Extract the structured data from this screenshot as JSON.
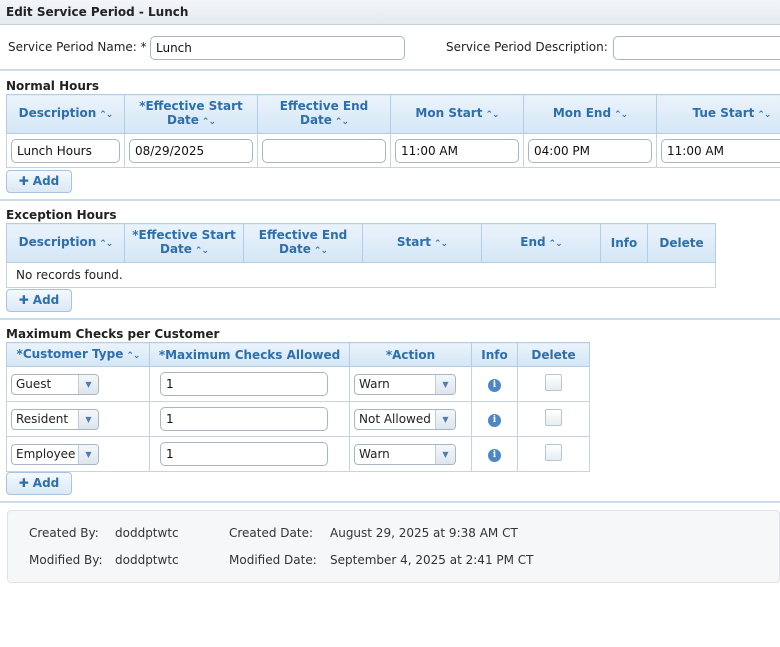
{
  "title": "Edit Service Period - Lunch",
  "form": {
    "name_label": "Service Period Name: *",
    "name_value": "Lunch",
    "desc_label": "Service Period Description:",
    "desc_value": ""
  },
  "normal_hours": {
    "title": "Normal Hours",
    "headers": [
      "Description",
      "*Effective Start Date",
      "Effective End Date",
      "Mon Start",
      "Mon End",
      "Tue Start"
    ],
    "rows": [
      {
        "description": "Lunch Hours",
        "start_date": "08/29/2025",
        "end_date": "",
        "mon_start": "11:00 AM",
        "mon_end": "04:00 PM",
        "tue_start": "11:00 AM"
      }
    ],
    "add_label": "Add"
  },
  "exception_hours": {
    "title": "Exception Hours",
    "headers": [
      "Description",
      "*Effective Start Date",
      "Effective End Date",
      "Start",
      "End",
      "Info",
      "Delete"
    ],
    "empty_text": "No records found.",
    "add_label": "Add"
  },
  "max_checks": {
    "title": "Maximum Checks per Customer",
    "headers": [
      "*Customer Type",
      "*Maximum Checks Allowed",
      "*Action",
      "Info",
      "Delete"
    ],
    "rows": [
      {
        "type": "Guest",
        "max": "1",
        "action": "Warn"
      },
      {
        "type": "Resident",
        "max": "1",
        "action": "Not Allowed"
      },
      {
        "type": "Employee",
        "max": "1",
        "action": "Warn"
      }
    ],
    "add_label": "Add"
  },
  "audit": {
    "created_by_label": "Created By:",
    "created_by": "doddptwtc",
    "created_date_label": "Created Date:",
    "created_date": "August 29, 2025 at 9:38 AM CT",
    "modified_by_label": "Modified By:",
    "modified_by": "doddptwtc",
    "modified_date_label": "Modified Date:",
    "modified_date": "September 4, 2025 at 2:41 PM CT"
  },
  "colors": {
    "header_text": "#2e6fab",
    "divider": "#c9dced",
    "info_icon": "#4d87c7"
  },
  "icons": {
    "sort": "sort-arrows-icon",
    "add": "plus-icon",
    "dropdown": "chevron-down-icon",
    "info": "info-icon"
  }
}
